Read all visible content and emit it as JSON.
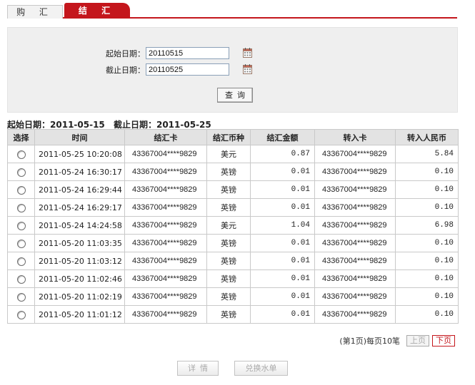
{
  "tabs": [
    {
      "label": "购 汇",
      "active": false
    },
    {
      "label": "结 汇",
      "active": true
    }
  ],
  "search": {
    "start_label": "起始日期：",
    "start_value": "20110515",
    "end_label": "截止日期：",
    "end_value": "20110525",
    "query_label": "查询"
  },
  "range": {
    "start_label": "起始日期：",
    "start_value": "2011-05-15",
    "end_label": "截止日期：",
    "end_value": "2011-05-25"
  },
  "table": {
    "headers": [
      "选择",
      "时间",
      "结汇卡",
      "结汇币种",
      "结汇金额",
      "转入卡",
      "转入人民币"
    ],
    "rows": [
      {
        "time": "2011-05-25 10:20:08",
        "card": "43367004****9829",
        "currency": "美元",
        "amount": "0.87",
        "to_card": "43367004****9829",
        "rmb": "5.84"
      },
      {
        "time": "2011-05-24 16:30:17",
        "card": "43367004****9829",
        "currency": "英镑",
        "amount": "0.01",
        "to_card": "43367004****9829",
        "rmb": "0.10"
      },
      {
        "time": "2011-05-24 16:29:44",
        "card": "43367004****9829",
        "currency": "英镑",
        "amount": "0.01",
        "to_card": "43367004****9829",
        "rmb": "0.10"
      },
      {
        "time": "2011-05-24 16:29:17",
        "card": "43367004****9829",
        "currency": "英镑",
        "amount": "0.01",
        "to_card": "43367004****9829",
        "rmb": "0.10"
      },
      {
        "time": "2011-05-24 14:24:58",
        "card": "43367004****9829",
        "currency": "美元",
        "amount": "1.04",
        "to_card": "43367004****9829",
        "rmb": "6.98"
      },
      {
        "time": "2011-05-20 11:03:35",
        "card": "43367004****9829",
        "currency": "英镑",
        "amount": "0.01",
        "to_card": "43367004****9829",
        "rmb": "0.10"
      },
      {
        "time": "2011-05-20 11:03:12",
        "card": "43367004****9829",
        "currency": "英镑",
        "amount": "0.01",
        "to_card": "43367004****9829",
        "rmb": "0.10"
      },
      {
        "time": "2011-05-20 11:02:46",
        "card": "43367004****9829",
        "currency": "英镑",
        "amount": "0.01",
        "to_card": "43367004****9829",
        "rmb": "0.10"
      },
      {
        "time": "2011-05-20 11:02:19",
        "card": "43367004****9829",
        "currency": "英镑",
        "amount": "0.01",
        "to_card": "43367004****9829",
        "rmb": "0.10"
      },
      {
        "time": "2011-05-20 11:01:12",
        "card": "43367004****9829",
        "currency": "英镑",
        "amount": "0.01",
        "to_card": "43367004****9829",
        "rmb": "0.10"
      }
    ]
  },
  "paging": {
    "info": "(第1页)每页10笔",
    "prev_label": "上页",
    "next_label": "下页"
  },
  "actions": {
    "detail_label": "详情",
    "receipt_label": "兑换水单"
  },
  "colors": {
    "accent": "#c4161c",
    "panel_bg": "#efefef",
    "header_bg": "#e3e3e3"
  },
  "icons": {
    "calendar": "calendar-icon",
    "radio": "radio-button"
  }
}
